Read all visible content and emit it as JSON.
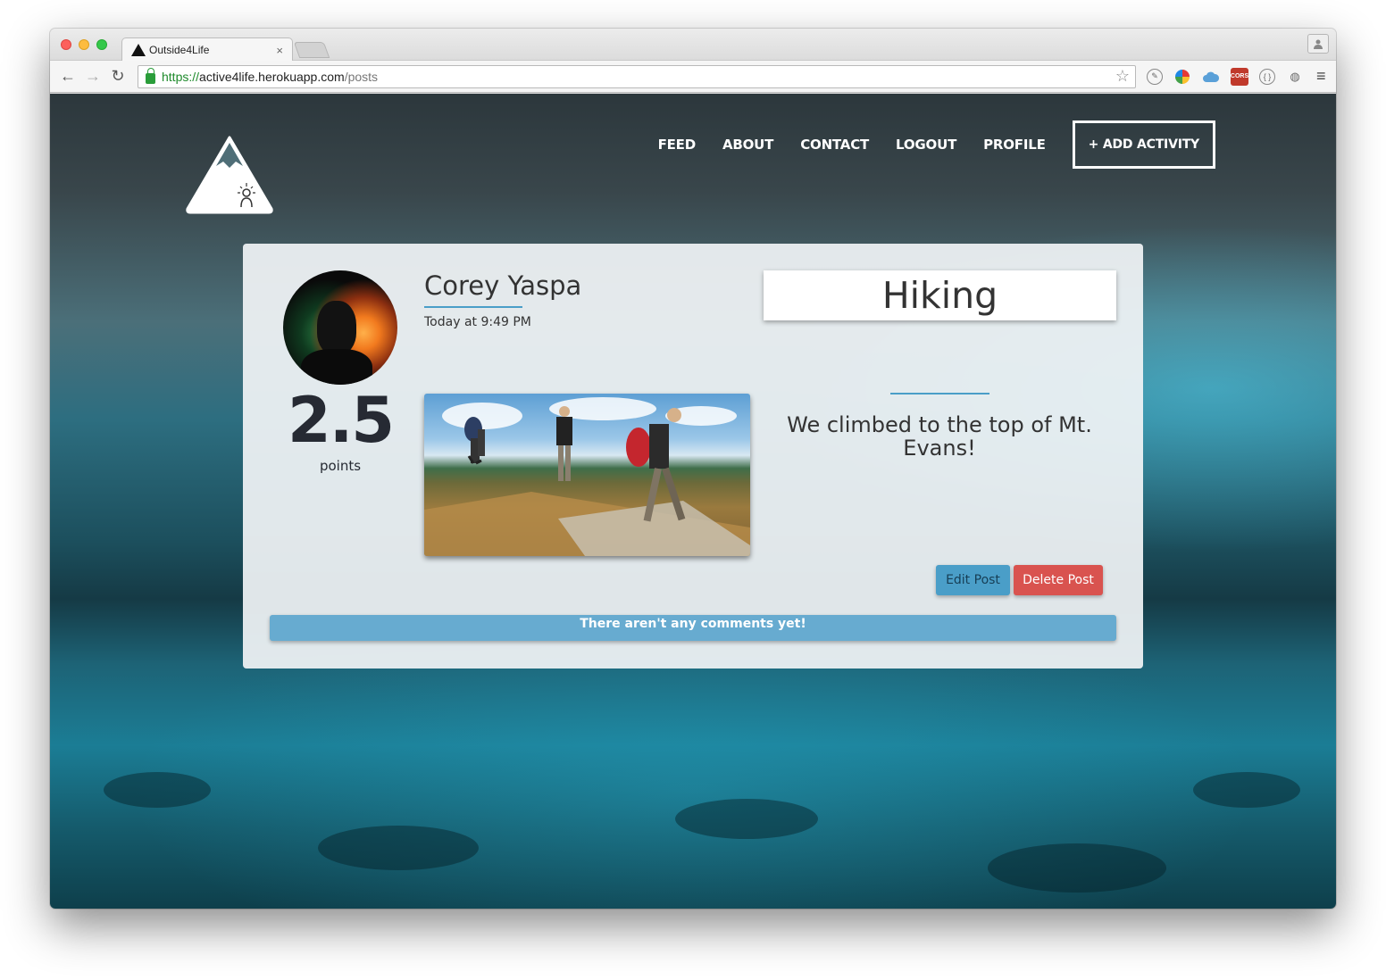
{
  "browser": {
    "tab_title": "Outside4Life",
    "tab_close": "×",
    "url_scheme": "https://",
    "url_host": "active4life.herokuapp.com",
    "url_path": "/posts",
    "extensions": [
      "evernote-icon",
      "color-picker-icon",
      "cloud-icon",
      "cors-icon",
      "code-icon",
      "webpage-icon"
    ],
    "cors_label": "CORS",
    "menu_glyph": "≡"
  },
  "nav": {
    "items": [
      "FEED",
      "ABOUT",
      "CONTACT",
      "LOGOUT",
      "PROFILE"
    ],
    "add_activity": "+ ADD ACTIVITY"
  },
  "post": {
    "user_name": "Corey Yaspa",
    "timestamp": "Today at 9:49 PM",
    "points_value": "2.5",
    "points_label": "points",
    "activity": "Hiking",
    "description": "We climbed to the top of Mt. Evans!",
    "edit_label": "Edit Post",
    "delete_label": "Delete Post",
    "comments_text": "There aren't any comments yet!"
  },
  "colors": {
    "accent": "#4a9ec8",
    "danger": "#d9534f",
    "comments_bar": "#67abd0",
    "text": "#333333"
  }
}
